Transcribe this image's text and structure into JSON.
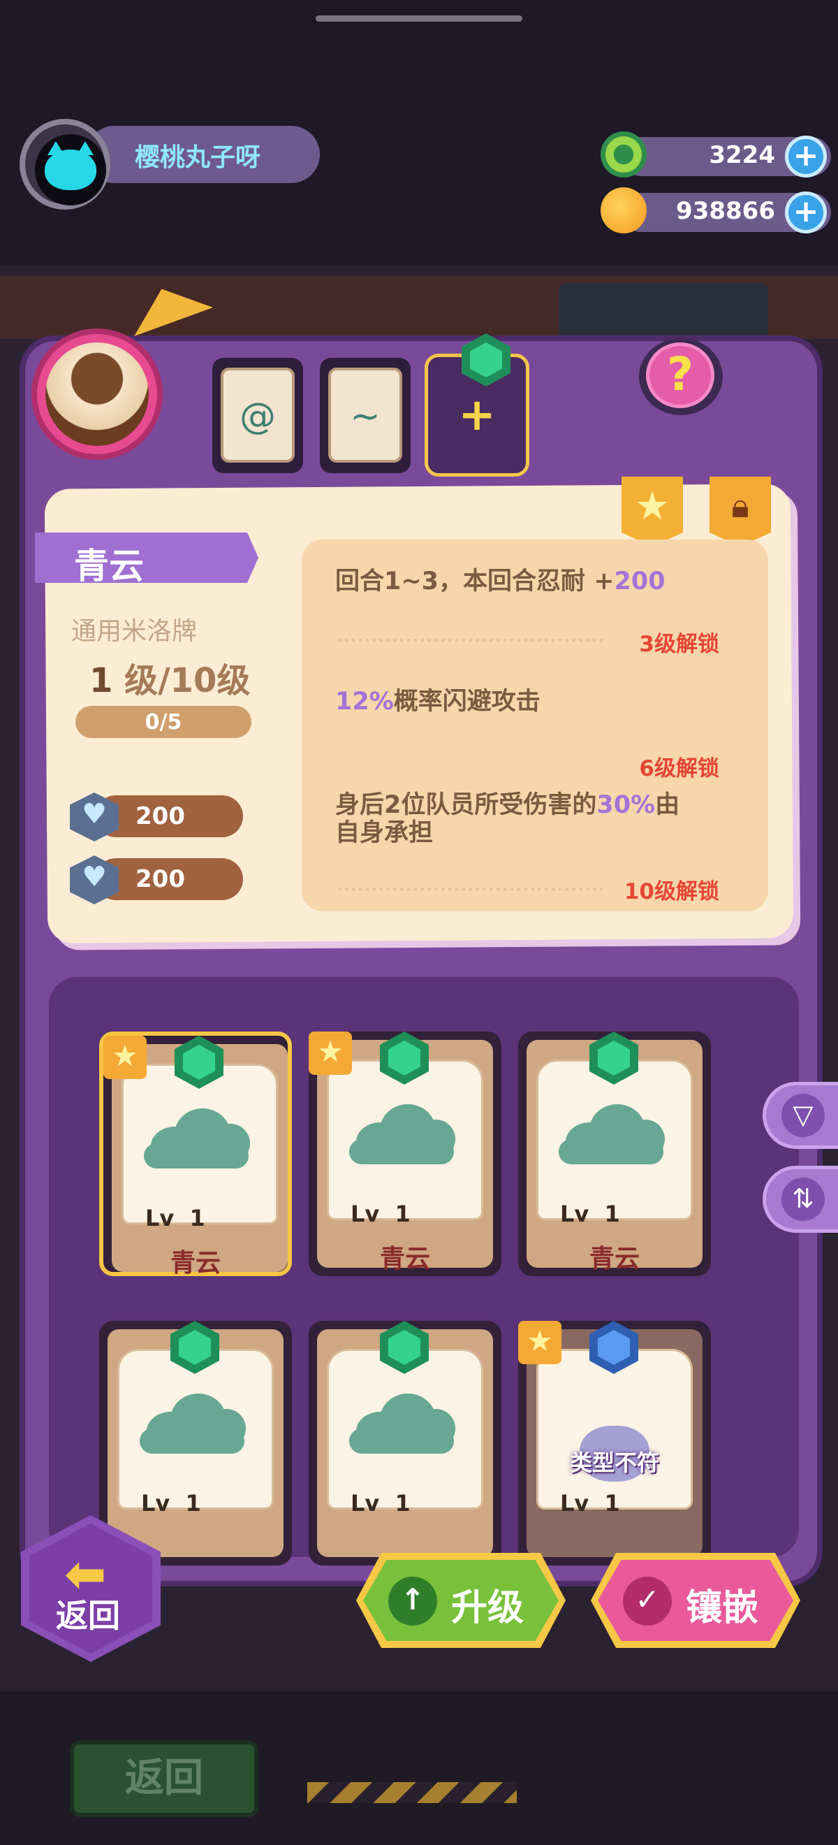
{
  "player": {
    "name": "樱桃丸子呀"
  },
  "currencies": [
    {
      "icon": "green-ring-coin-icon",
      "value": "3224"
    },
    {
      "icon": "gold-planet-coin-icon",
      "value": "938866"
    }
  ],
  "card_detail": {
    "name": "青云",
    "type": "通用米洛牌",
    "level_current": "1",
    "level_text": "级/10级",
    "progress_text": "0/5",
    "progress": 0,
    "stats": [
      {
        "icon": "heart-shield-icon",
        "value": "200"
      },
      {
        "icon": "heart-shield-icon",
        "value": "200"
      }
    ],
    "skills": [
      {
        "text_a": "回合1~3，本回合忍耐 +",
        "highlight": "200",
        "text_b": "",
        "unlock": "3级解锁"
      },
      {
        "text_a": "",
        "highlight": "12%",
        "text_b": "概率闪避攻击",
        "unlock": "6级解锁"
      },
      {
        "text_a": "身后2位队员所受伤害的",
        "highlight": "30%",
        "text_b": "由",
        "line2": "自身承担",
        "unlock": "10级解锁"
      }
    ]
  },
  "slots": [
    {
      "glyph": "swirl-icon"
    },
    {
      "glyph": "bird-icon"
    }
  ],
  "inventory": [
    {
      "lv_label": "Lv",
      "lv": "1",
      "name": "青云",
      "starred": true,
      "selected": true
    },
    {
      "lv_label": "Lv",
      "lv": "1",
      "name": "青云",
      "starred": true,
      "selected": false
    },
    {
      "lv_label": "Lv",
      "lv": "1",
      "name": "青云",
      "starred": false,
      "selected": false
    },
    {
      "lv_label": "Lv",
      "lv": "1",
      "name": "",
      "starred": false,
      "selected": false
    },
    {
      "lv_label": "Lv",
      "lv": "1",
      "name": "",
      "starred": false,
      "selected": false
    },
    {
      "lv_label": "Lv",
      "lv": "1",
      "name": "",
      "starred": true,
      "selected": false,
      "overlay": "类型不符"
    }
  ],
  "buttons": {
    "back": "返回",
    "upgrade": "升级",
    "inlay": "镶嵌",
    "bg_back": "返回"
  },
  "colors": {
    "panel": "#7a4a9a",
    "accent_yellow": "#f6c846",
    "upgrade_green": "#79c13b",
    "inlay_pink": "#ea5a9a",
    "unlock_red": "#e44735"
  }
}
